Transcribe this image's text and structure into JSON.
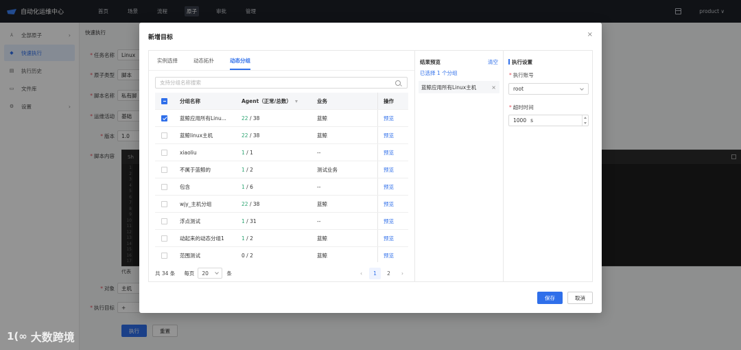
{
  "app": {
    "title": "自动化运维中心",
    "user": "product ∨"
  },
  "topnav": [
    "首页",
    "场景",
    "流程",
    "原子",
    "审批",
    "管理"
  ],
  "sidebar": [
    {
      "label": "全部原子",
      "icon": "⅄"
    },
    {
      "label": "快速执行",
      "icon": "◆"
    },
    {
      "label": "执行历史",
      "icon": "▤"
    },
    {
      "label": "文件库",
      "icon": "▭"
    },
    {
      "label": "设置",
      "icon": "⚙"
    }
  ],
  "page": {
    "breadcrumb": "快速执行",
    "labels": {
      "task_name": "任务名称",
      "atom_type": "原子类型",
      "script_name": "脚本名称",
      "ops_activity": "运维活动",
      "version": "版本",
      "script_content": "脚本内容",
      "target": "对象",
      "exec_target": "执行目标"
    },
    "values": {
      "task_name": "Linux",
      "atom_type": "脚本",
      "script_name": "私有脚",
      "ops_activity": "基础",
      "version": "1.0",
      "target": "主机",
      "exec_target": "+"
    },
    "code_lang": "Sh",
    "code_note": "代表",
    "code_line_numbers": [
      "1",
      "2",
      "3",
      "4",
      "5",
      "6",
      "7",
      "8",
      "9",
      "10",
      "11",
      "12",
      "13",
      "14",
      "15",
      "16",
      "17"
    ],
    "execute_btn": "执行",
    "reset_btn": "重置"
  },
  "modal": {
    "title": "新增目标",
    "close": "×",
    "tabs": [
      "实例选择",
      "动态拓扑",
      "动态分组"
    ],
    "active_tab": 2,
    "search_placeholder": "支持分组名称搜索",
    "columns": {
      "name": "分组名称",
      "agent": "Agent（正常/总数）",
      "biz": "业务",
      "op": "操作"
    },
    "rows": [
      {
        "checked": true,
        "name": "蓝鲸应用所有Linu...",
        "agent_ok": "22",
        "agent_total": "/ 38",
        "biz": "蓝鲸",
        "op": "预览"
      },
      {
        "checked": false,
        "name": "蓝鲸linux主机",
        "agent_ok": "22",
        "agent_total": "/ 38",
        "biz": "蓝鲸",
        "op": "预览"
      },
      {
        "checked": false,
        "name": "xiaoliu",
        "agent_ok": "1",
        "agent_total": "/ 1",
        "biz": "--",
        "op": "预览"
      },
      {
        "checked": false,
        "name": "不属于蓝鲸的",
        "agent_ok": "1",
        "agent_total": "/ 2",
        "biz": "测试业务",
        "op": "预览"
      },
      {
        "checked": false,
        "name": "包含",
        "agent_ok": "1",
        "agent_total": "/ 6",
        "biz": "--",
        "op": "预览"
      },
      {
        "checked": false,
        "name": "wjy_主机分组",
        "agent_ok": "22",
        "agent_total": "/ 38",
        "biz": "蓝鲸",
        "op": "预览"
      },
      {
        "checked": false,
        "name": "浮点测试",
        "agent_ok": "1",
        "agent_total": "/ 31",
        "biz": "--",
        "op": "预览"
      },
      {
        "checked": false,
        "name": "动起来的动态分组1",
        "agent_ok": "1",
        "agent_total": "/ 2",
        "biz": "蓝鲸",
        "op": "预览"
      },
      {
        "checked": false,
        "name": "范围测试",
        "agent_ok": "0",
        "agent_total": "/ 2",
        "biz": "蓝鲸",
        "op": "预览"
      }
    ],
    "pager": {
      "total": "共 34 条",
      "size_label": "每页",
      "size": "20",
      "unit": "条",
      "pages": [
        "1",
        "2"
      ],
      "current": "1",
      "prev": "‹",
      "next": "›"
    },
    "result": {
      "title": "结果预览",
      "clear": "清空",
      "count_prefix": "已选择",
      "count": "1",
      "count_suffix": "个分组",
      "items": [
        "蓝鲸应用所有Linux主机"
      ]
    },
    "settings": {
      "title": "执行设置",
      "account_label": "执行账号",
      "account": "root",
      "timeout_label": "超时时间",
      "timeout": "1000",
      "timeout_unit": "s"
    },
    "save": "保存",
    "cancel": "取消"
  },
  "watermark": {
    "logo": "1(∞",
    "text": "大数跨境"
  },
  "colors": {
    "primary": "#2f6fea",
    "ok": "#2ba471",
    "topbar": "#1c1f26"
  }
}
